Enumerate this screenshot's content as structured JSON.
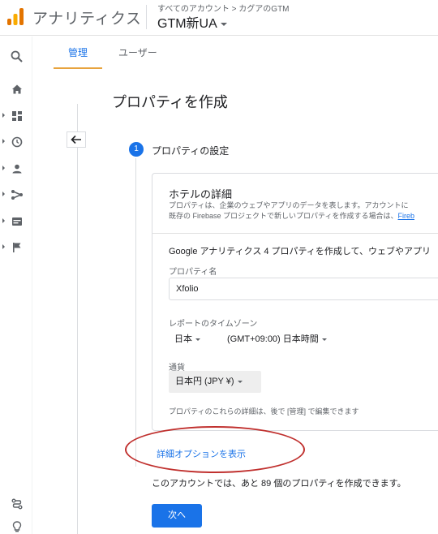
{
  "header": {
    "app_title": "アナリティクス",
    "breadcrumb": "すべてのアカウント > カグアのGTM",
    "property_name": "GTM新UA",
    "brand_colors": {
      "logo_light": "#f9ab00",
      "logo_dark": "#e37400"
    }
  },
  "sidenav": {
    "items": [
      {
        "icon": "search-icon"
      },
      {
        "icon": "home-icon"
      },
      {
        "icon": "dashboard-icon"
      },
      {
        "icon": "clock-icon"
      },
      {
        "icon": "person-icon"
      },
      {
        "icon": "acquisition-icon"
      },
      {
        "icon": "screen-icon"
      },
      {
        "icon": "flag-icon"
      },
      {
        "icon": "route-icon"
      },
      {
        "icon": "lightbulb-icon"
      }
    ]
  },
  "tabs": [
    {
      "label": "管理",
      "active": true
    },
    {
      "label": "ユーザー",
      "active": false
    }
  ],
  "page": {
    "title": "プロパティを作成"
  },
  "step": {
    "number": "1",
    "label": "プロパティの設定"
  },
  "card": {
    "title": "ホテルの詳細",
    "desc_line1": "プロパティは、企業のウェブやアプリのデータを表します。アカウントに",
    "desc_line2_prefix": "既存の Firebase プロジェクトで新しいプロパティを作成する場合は、",
    "desc_link": "Fireb",
    "intro": "Google アナリティクス 4 プロパティを作成して、ウェブやアプリ",
    "property_name_label": "プロパティ名",
    "property_name_value": "Xfolio",
    "timezone_label": "レポートのタイムゾーン",
    "timezone_country": "日本",
    "timezone_value": "(GMT+09:00) 日本時間",
    "currency_label": "通貨",
    "currency_value": "日本円 (JPY ¥)",
    "note": "プロパティのこれらの詳細は、後で [管理] で編集できます"
  },
  "advanced_link": "詳細オプションを表示",
  "remaining_text": "このアカウントでは、あと 89 個のプロパティを作成できます。",
  "next_button": "次へ",
  "colors": {
    "accent": "#1a73e8",
    "tab_underline": "#e8a33d",
    "annotation": "#c0302e"
  }
}
